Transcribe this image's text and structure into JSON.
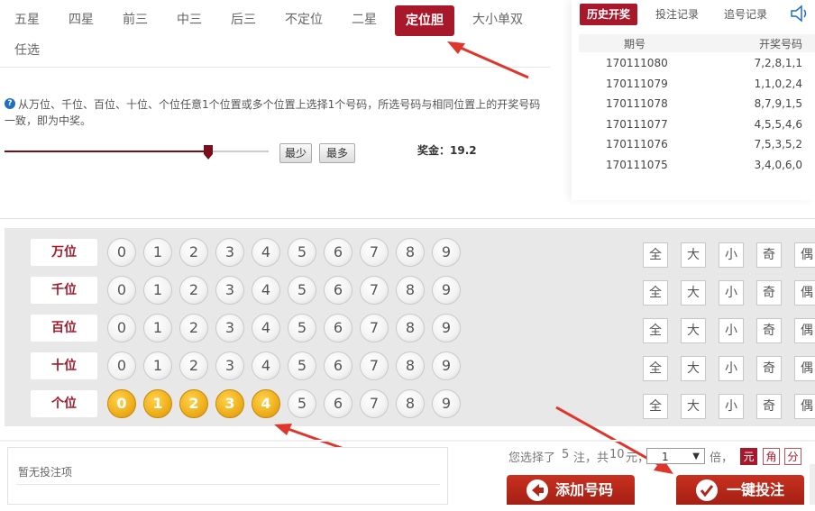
{
  "tabs": [
    {
      "label": "五星",
      "active": false
    },
    {
      "label": "四星",
      "active": false
    },
    {
      "label": "前三",
      "active": false
    },
    {
      "label": "中三",
      "active": false
    },
    {
      "label": "后三",
      "active": false
    },
    {
      "label": "不定位",
      "active": false
    },
    {
      "label": "二星",
      "active": false
    },
    {
      "label": "定位胆",
      "active": true
    },
    {
      "label": "大小单双",
      "active": false
    },
    {
      "label": "任选",
      "active": false
    }
  ],
  "rule_text": "从万位、千位、百位、十位、个位任意1个位置或多个位置上选择1个号码，所选号码与相同位置上的开奖号码一致，即为中奖。",
  "rebate": {
    "slider_fraction": 0.77,
    "min_label": "最少",
    "max_label": "最多",
    "prize_label": "奖金：19.2"
  },
  "history": {
    "tabs": [
      {
        "label": "历史开奖",
        "active": true
      },
      {
        "label": "投注记录",
        "active": false
      },
      {
        "label": "追号记录",
        "active": false
      }
    ],
    "sound_icon": "speaker-icon",
    "col_issue": "期号",
    "col_result": "开奖号码",
    "rows": [
      {
        "issue": "170111080",
        "result": "7,2,8,1,1"
      },
      {
        "issue": "170111079",
        "result": "1,1,0,2,4"
      },
      {
        "issue": "170111078",
        "result": "8,7,9,1,5"
      },
      {
        "issue": "170111077",
        "result": "4,5,5,4,6"
      },
      {
        "issue": "170111076",
        "result": "7,5,3,5,2"
      },
      {
        "issue": "170111075",
        "result": "3,4,0,6,0"
      }
    ]
  },
  "positions": [
    {
      "label": "万位",
      "selected": []
    },
    {
      "label": "千位",
      "selected": []
    },
    {
      "label": "百位",
      "selected": []
    },
    {
      "label": "十位",
      "selected": []
    },
    {
      "label": "个位",
      "selected": [
        0,
        1,
        2,
        3,
        4
      ]
    }
  ],
  "digits": [
    "0",
    "1",
    "2",
    "3",
    "4",
    "5",
    "6",
    "7",
    "8",
    "9"
  ],
  "quick_select": [
    "全",
    "大",
    "小",
    "奇",
    "偶"
  ],
  "bet_list": {
    "empty_text": "暂无投注项"
  },
  "summary": {
    "prefix": "您选择了",
    "count": "5",
    "mid1": "注，共",
    "amount": "10",
    "mid2": "元，",
    "multiplier": "1",
    "suffix": "倍，"
  },
  "units": [
    {
      "label": "元",
      "active": true
    },
    {
      "label": "角",
      "active": false
    },
    {
      "label": "分",
      "active": false
    }
  ],
  "actions": {
    "add_label": "添加号码",
    "submit_label": "一键投注"
  },
  "colors": {
    "accent": "#a8182b",
    "selected_ball": "#f0b21e"
  }
}
